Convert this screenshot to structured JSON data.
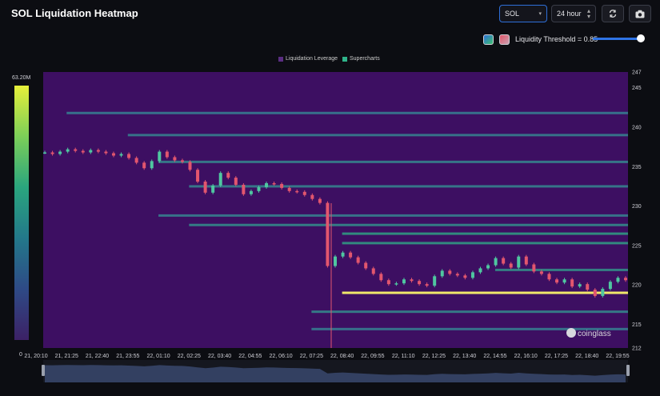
{
  "header": {
    "title": "SOL Liquidation Heatmap",
    "symbol": "SOL",
    "range": "24 hour",
    "threshold_label": "Liquidity Threshold = 0.85",
    "threshold_value": 0.85
  },
  "legend": {
    "leverage": "Liquidation Leverage",
    "supercharts": "Supercharts",
    "leverage_color": "#5a2d82",
    "supercharts_color": "#2fb38a"
  },
  "colorbar": {
    "max_label": "63.20M",
    "min_label": "0"
  },
  "watermark": "coinglass",
  "chart_data": {
    "type": "heatmap",
    "title": "SOL Liquidation Heatmap",
    "x_tick_labels": [
      "21, 20:10",
      "21, 21:25",
      "21, 22:40",
      "21, 23:55",
      "22, 01:10",
      "22, 02:25",
      "22, 03:40",
      "22, 04:55",
      "22, 06:10",
      "22, 07:25",
      "22, 08:40",
      "22, 09:55",
      "22, 11:10",
      "22, 12:25",
      "22, 13:40",
      "22, 14:55",
      "22, 16:10",
      "22, 17:25",
      "22, 18:40",
      "22, 19:55"
    ],
    "y_tick_labels": [
      "247",
      "245",
      "240",
      "235",
      "230",
      "225",
      "220",
      "215",
      "212"
    ],
    "y_ticks": [
      247,
      245,
      240,
      235,
      230,
      225,
      220,
      215,
      212
    ],
    "ylim": [
      212,
      247
    ],
    "price_points": [
      236.8,
      236.6,
      236.9,
      237.2,
      237.0,
      236.8,
      237.1,
      236.9,
      236.7,
      236.4,
      236.6,
      236.1,
      235.5,
      234.8,
      235.7,
      236.9,
      236.2,
      235.8,
      235.6,
      234.6,
      233.1,
      231.7,
      232.6,
      234.2,
      233.6,
      232.7,
      231.5,
      231.9,
      232.4,
      232.9,
      232.8,
      232.3,
      231.9,
      231.8,
      231.4,
      230.9,
      230.4,
      222.4,
      223.6,
      224.1,
      223.5,
      222.8,
      222.1,
      221.4,
      220.6,
      220.1,
      220.2,
      220.7,
      220.5,
      220.1,
      219.9,
      221.1,
      221.8,
      221.4,
      221.2,
      220.9,
      221.6,
      222.1,
      222.5,
      223.4,
      222.7,
      222.2,
      223.6,
      222.6,
      221.7,
      221.4,
      220.7,
      220.3,
      220.7,
      219.8,
      220.1,
      219.4,
      218.6,
      219.5,
      220.4,
      220.9,
      220.6
    ],
    "liquidity_bands": [
      {
        "from": "22, 08:40",
        "to": "22, 19:55",
        "price": 219.0,
        "intensity": 1.0
      },
      {
        "from": "22, 08:40",
        "to": "22, 19:55",
        "price": 226.5,
        "intensity": 0.8
      },
      {
        "from": "22, 08:40",
        "to": "22, 19:55",
        "price": 225.3,
        "intensity": 0.75
      },
      {
        "from": "22, 02:25",
        "to": "22, 19:55",
        "price": 227.6,
        "intensity": 0.55
      },
      {
        "from": "22, 01:10",
        "to": "22, 19:55",
        "price": 228.8,
        "intensity": 0.4
      },
      {
        "from": "22, 07:25",
        "to": "22, 19:55",
        "price": 216.6,
        "intensity": 0.5
      },
      {
        "from": "22, 02:25",
        "to": "22, 19:55",
        "price": 232.5,
        "intensity": 0.45
      },
      {
        "from": "22, 01:10",
        "to": "22, 19:55",
        "price": 235.6,
        "intensity": 0.45
      },
      {
        "from": "21, 23:55",
        "to": "22, 19:55",
        "price": 239.0,
        "intensity": 0.4
      },
      {
        "from": "21, 21:25",
        "to": "22, 19:55",
        "price": 241.8,
        "intensity": 0.35
      },
      {
        "from": "22, 14:55",
        "to": "22, 19:55",
        "price": 221.9,
        "intensity": 0.6
      },
      {
        "from": "22, 07:25",
        "to": "22, 19:55",
        "price": 214.4,
        "intensity": 0.35
      }
    ]
  }
}
